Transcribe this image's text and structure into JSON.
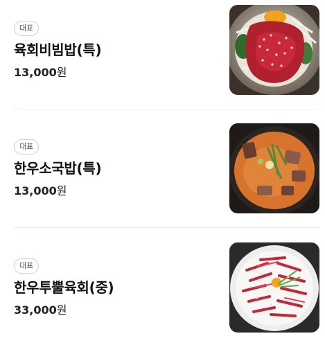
{
  "menu": {
    "items": [
      {
        "badge": "대표",
        "name": "육회비빔밥(특)",
        "price": "13,000",
        "currency": "원",
        "image_icon": "yukhoe-bibimbap-photo"
      },
      {
        "badge": "대표",
        "name": "한우소국밥(특)",
        "price": "13,000",
        "currency": "원",
        "image_icon": "beef-soup-gukbap-photo"
      },
      {
        "badge": "대표",
        "name": "한우투뿔육회(중)",
        "price": "33,000",
        "currency": "원",
        "image_icon": "beef-tartare-yukhoe-photo"
      }
    ]
  },
  "colors": {
    "background": "#ffffff",
    "divider": "#eeeeee",
    "badge_border": "#cfcfcf",
    "text": "#111111"
  }
}
